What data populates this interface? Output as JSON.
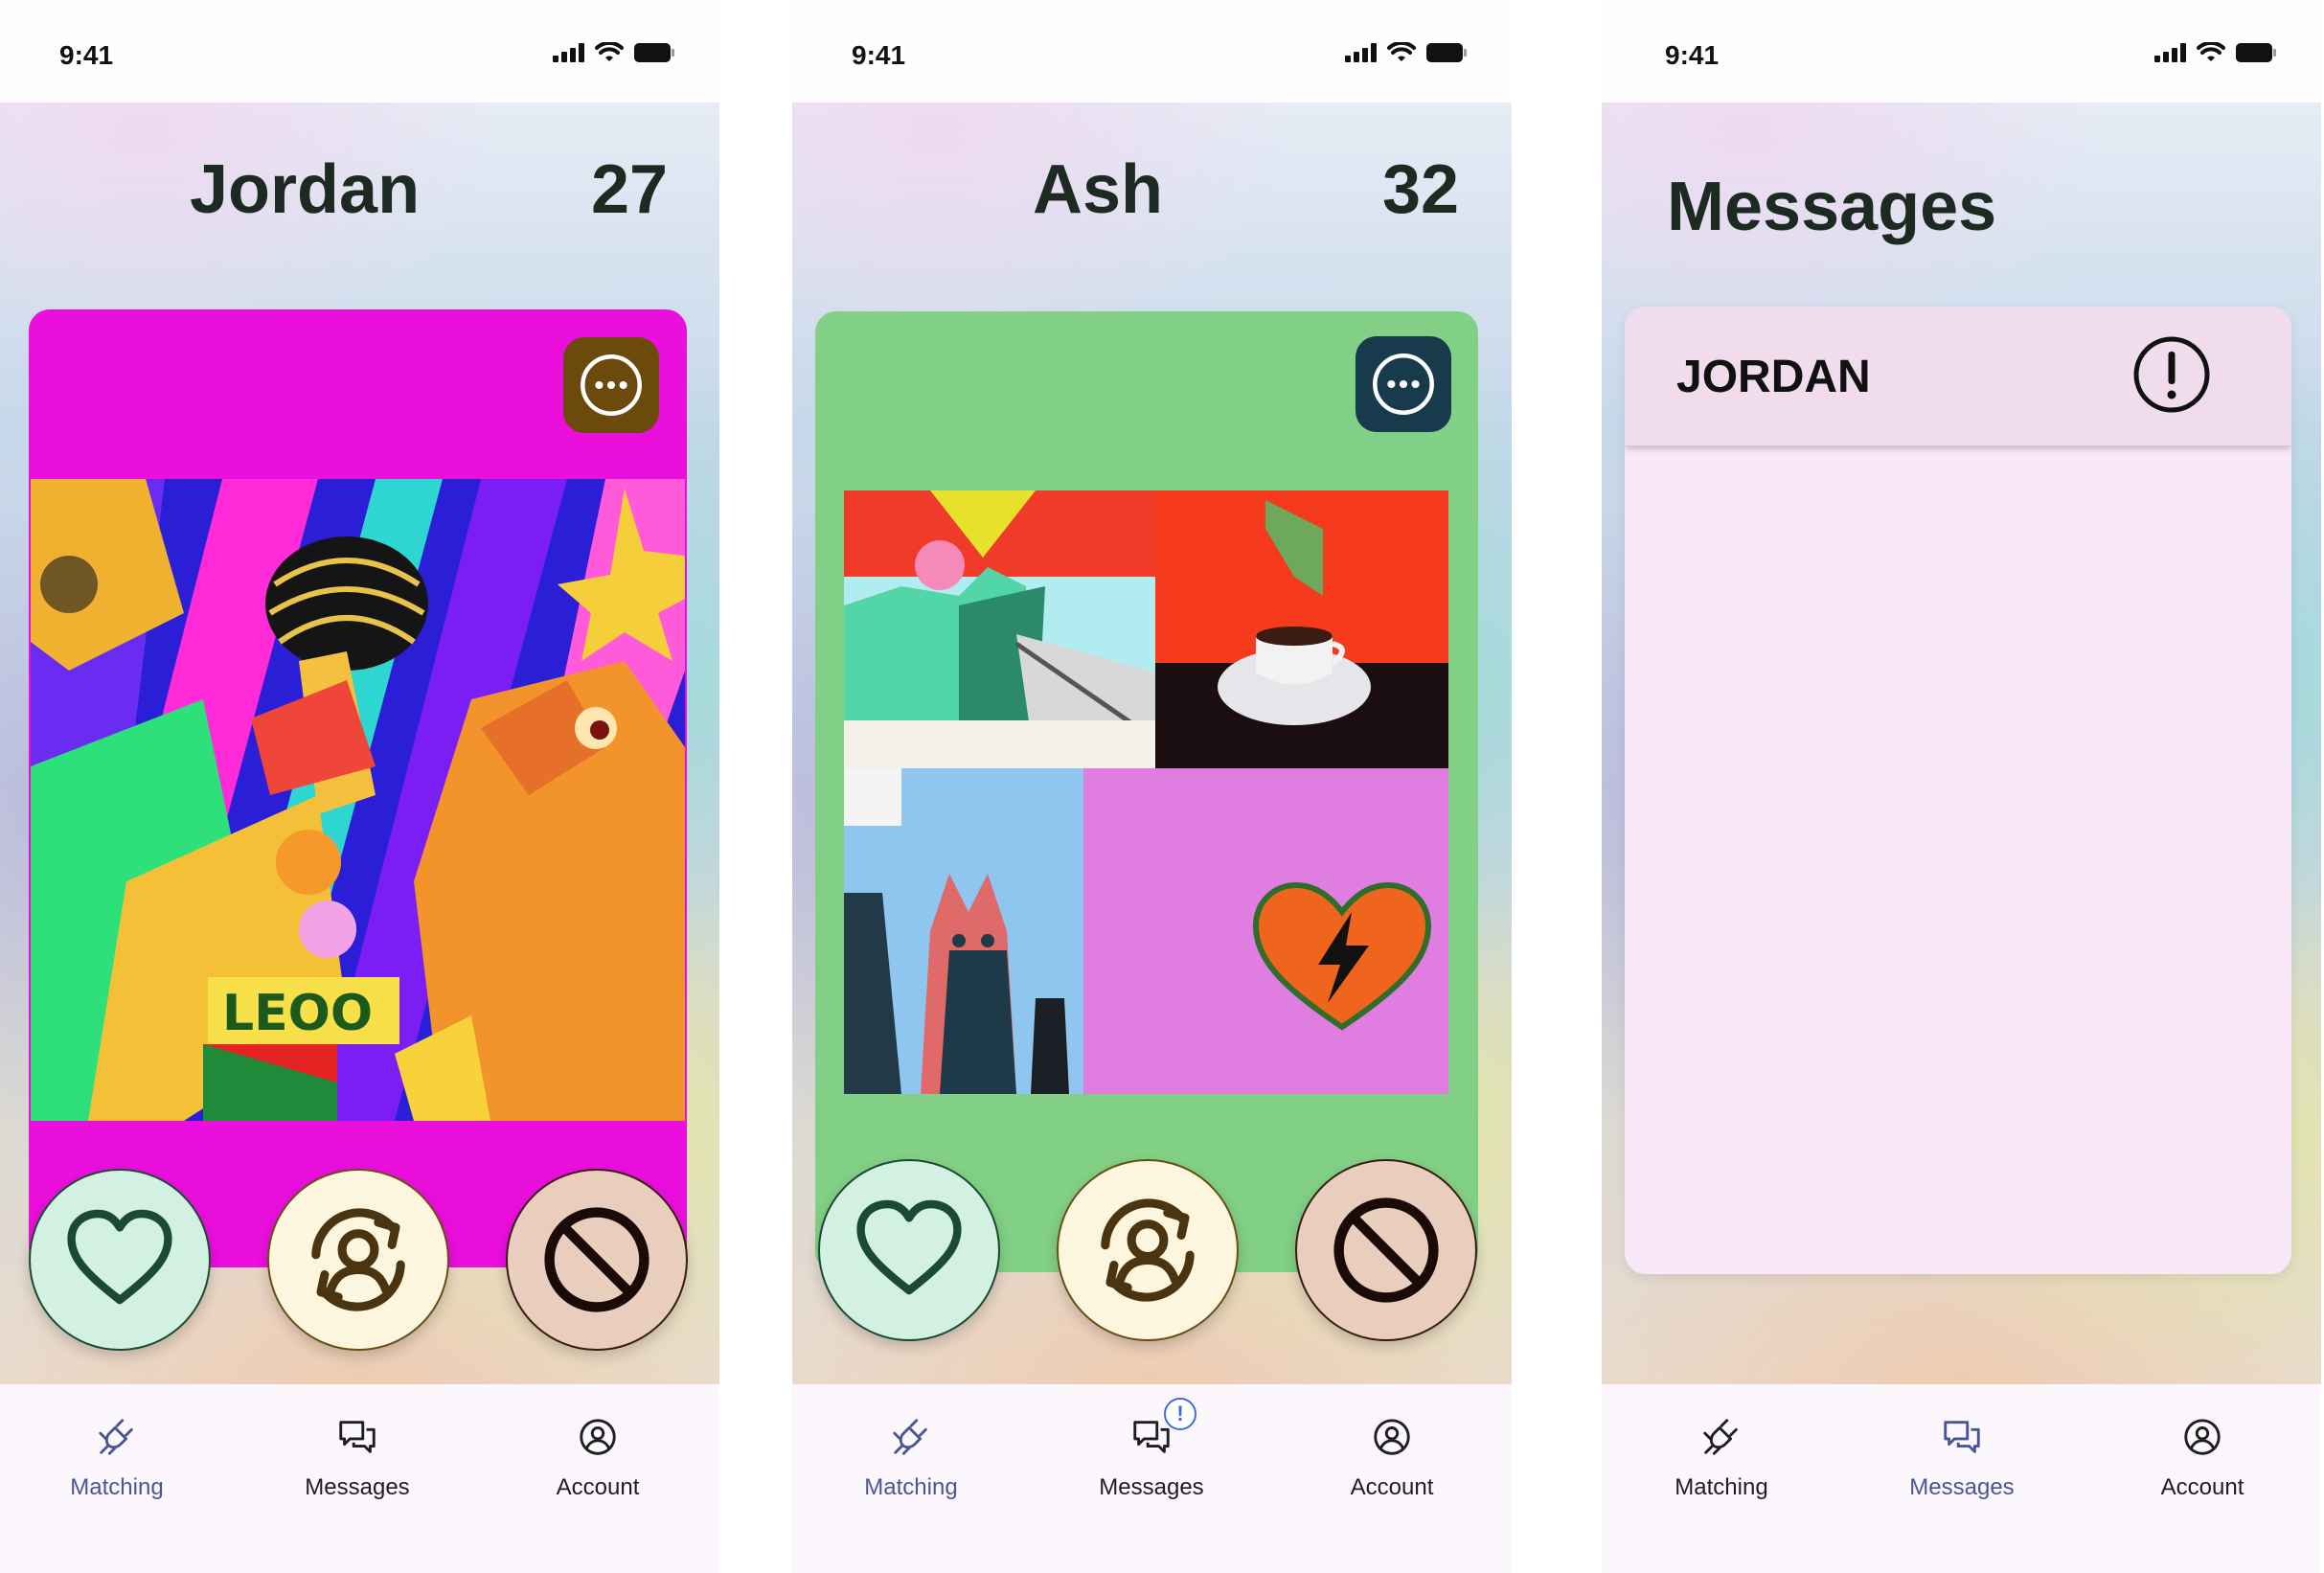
{
  "status": {
    "time": "9:41"
  },
  "screens": [
    {
      "profile": {
        "name": "Jordan",
        "age": "27"
      },
      "colors": {
        "card": "#ea0fdc",
        "more_button": "#6b4a0c"
      },
      "photo_text": "LEOO",
      "tabs": [
        {
          "label": "Matching",
          "icon": "plug-icon",
          "active": true
        },
        {
          "label": "Messages",
          "icon": "chat-bubbles-icon",
          "active": false
        },
        {
          "label": "Account",
          "icon": "user-circle-icon",
          "active": false
        }
      ]
    },
    {
      "profile": {
        "name": "Ash",
        "age": "32"
      },
      "colors": {
        "card": "#82d086",
        "more_button": "#173a4c"
      },
      "tabs": [
        {
          "label": "Matching",
          "icon": "plug-icon",
          "active": true
        },
        {
          "label": "Messages",
          "icon": "chat-bubbles-icon",
          "active": false,
          "badge": "!"
        },
        {
          "label": "Account",
          "icon": "user-circle-icon",
          "active": false
        }
      ]
    },
    {
      "title": "Messages",
      "conversations": [
        {
          "name": "JORDAN",
          "alert": true
        }
      ],
      "tabs": [
        {
          "label": "Matching",
          "icon": "plug-icon",
          "active": false
        },
        {
          "label": "Messages",
          "icon": "chat-bubbles-icon",
          "active": true
        },
        {
          "label": "Account",
          "icon": "user-circle-icon",
          "active": false
        }
      ]
    }
  ],
  "actions": {
    "like": "heart-icon",
    "refresh": "refresh-user-icon",
    "block": "block-icon"
  },
  "accent": "#4a5596"
}
